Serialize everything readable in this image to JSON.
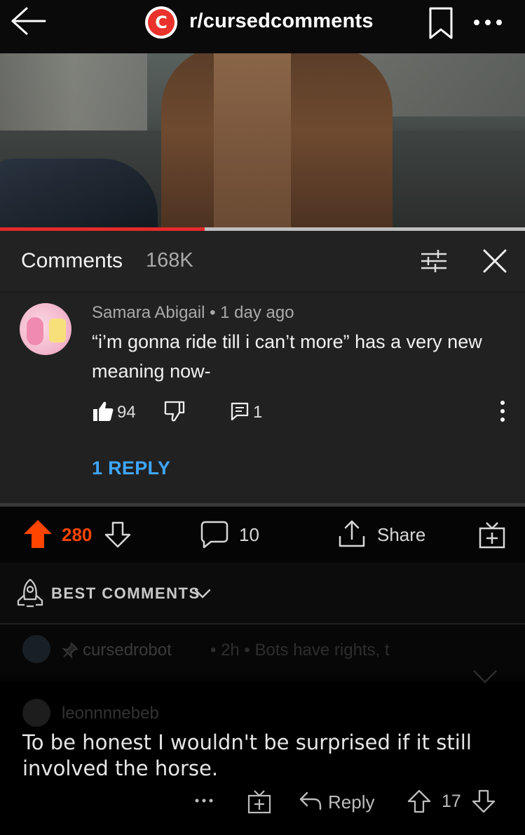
{
  "header": {
    "subreddit": "r/cursedcomments",
    "logo_letter": "C"
  },
  "video": {
    "progress": 0.39,
    "progress_color": "#e42a2a"
  },
  "comments_panel": {
    "title": "Comments",
    "count": "168K",
    "comment": {
      "author_line": "Samara Abigail • 1 day ago",
      "text": "“i’m gonna ride till i can’t more” has a very new meaning now-",
      "likes": "94",
      "replies_count": "1",
      "replies_link": "1 REPLY"
    }
  },
  "post_actions": {
    "score": "280",
    "comments": "10",
    "share_label": "Share",
    "upvote_color": "#ff4500"
  },
  "sort": {
    "label": "BEST COMMENTS"
  },
  "bot_comment": {
    "author": "cursedrobot",
    "meta": "• 2h • Bots have rights, t"
  },
  "top_comment": {
    "author": "leonnnnebeb",
    "body": "To be honest I wouldn't be surprised if it still involved the horse.",
    "reply_label": "Reply",
    "score": "17"
  }
}
